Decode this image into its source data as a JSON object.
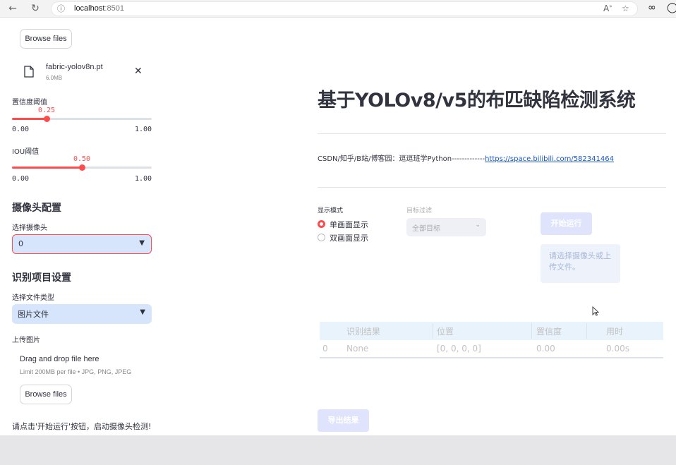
{
  "browser": {
    "url_host": "localhost",
    "url_port": ":8501"
  },
  "sidebar": {
    "browse_top_label": "Browse files",
    "uploaded_file": {
      "name": "fabric-yolov8n.pt",
      "size": "6.0MB"
    },
    "confidence": {
      "label": "置信度阈值",
      "value": "0.25",
      "value_num": 0.25,
      "min": "0.00",
      "max": "1.00"
    },
    "iou": {
      "label": "IOU阈值",
      "value": "0.50",
      "value_num": 0.5,
      "min": "0.00",
      "max": "1.00"
    },
    "camera_section": "摄像头配置",
    "camera_select_label": "选择摄像头",
    "camera_select_value": "0",
    "recog_section": "识别项目设置",
    "file_type_label": "选择文件类型",
    "file_type_value": "图片文件",
    "upload_label": "上传图片",
    "dropzone_title": "Drag and drop file here",
    "dropzone_limit": "Limit 200MB per file • JPG, PNG, JPEG",
    "browse_label": "Browse files",
    "info_text": "请点击'开始运行'按钮，启动摄像头检测!"
  },
  "main": {
    "title": "基于YOLOv8/v5的布匹缺陷检测系统",
    "credit_prefix": "CSDN/知乎/B站/博客园：逗逗班学Python-------------",
    "credit_link": "https://space.bilibili.com/582341464",
    "display_mode_label": "显示模式",
    "display_modes": [
      "单画面显示",
      "双画面显示"
    ],
    "filter_label": "目标过滤",
    "filter_value": "全部目标",
    "start_button": "开始运行",
    "warning_text": "请选择摄像头或上传文件。",
    "table": {
      "columns": [
        "识别结果",
        "位置",
        "置信度",
        "用时"
      ],
      "rows": [
        {
          "index": "0",
          "result": "None",
          "position": "[0, 0, 0, 0]",
          "confidence": "0.00",
          "time": "0.00s"
        }
      ]
    },
    "export_button": "导出结果"
  }
}
